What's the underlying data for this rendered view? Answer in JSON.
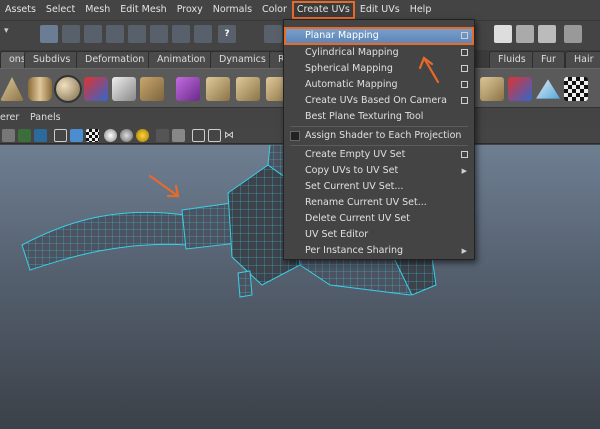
{
  "menubar": {
    "items": [
      "Assets",
      "Select",
      "Mesh",
      "Edit Mesh",
      "Proxy",
      "Normals",
      "Color",
      "Create UVs",
      "Edit UVs",
      "Help"
    ],
    "active": "Create UVs",
    "highlight_color": "#e86a2a"
  },
  "shelf_tabs": [
    "ons",
    "Subdivs",
    "Deformation",
    "Animation",
    "Dynamics",
    "R",
    "Fluids",
    "Fur",
    "Hair"
  ],
  "panel_menu": [
    "erer",
    "Panels"
  ],
  "dropdown": {
    "items": [
      {
        "label": "Planar Mapping",
        "option_box": true,
        "highlighted": true
      },
      {
        "label": "Cylindrical Mapping",
        "option_box": true
      },
      {
        "label": "Spherical Mapping",
        "option_box": true
      },
      {
        "label": "Automatic Mapping",
        "option_box": true
      },
      {
        "label": "Create UVs Based On Camera",
        "option_box": true
      },
      {
        "label": "Best Plane Texturing Tool"
      },
      {
        "label": "Assign Shader to Each Projection",
        "checkbox": true
      },
      {
        "label": "Create Empty UV Set",
        "option_box": true
      },
      {
        "label": "Copy UVs to UV Set",
        "submenu": true
      },
      {
        "label": "Set Current UV Set..."
      },
      {
        "label": "Rename Current UV Set..."
      },
      {
        "label": "Delete Current UV Set"
      },
      {
        "label": "UV Set Editor"
      },
      {
        "label": "Per Instance Sharing",
        "submenu": true
      }
    ]
  },
  "colors": {
    "accent": "#e86a2a",
    "menu_highlight": "#5b84b5",
    "wireframe": "#39d0e6"
  }
}
